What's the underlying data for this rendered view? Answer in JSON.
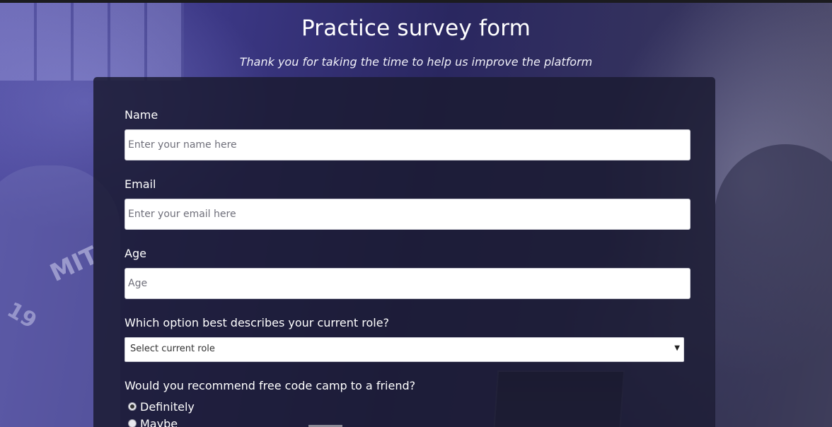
{
  "header": {
    "title": "Practice survey form",
    "description": "Thank you for taking the time to help us improve the platform"
  },
  "form": {
    "name": {
      "label": "Name",
      "placeholder": "Enter your name here"
    },
    "email": {
      "label": "Email",
      "placeholder": "Enter your email here"
    },
    "age": {
      "label": "Age",
      "placeholder": "Age"
    },
    "role": {
      "label": "Which option best describes your current role?",
      "selected": "Select current role",
      "arrow": "▼"
    },
    "recommend": {
      "label": "Would you recommend free code camp to a friend?",
      "options": [
        {
          "label": "Definitely",
          "checked": true
        },
        {
          "label": "Maybe",
          "checked": false
        }
      ]
    }
  },
  "background": {
    "shirt_text": "MIT",
    "shirt_number": "19"
  },
  "colors": {
    "card_bg": "#1b1b32",
    "text": "#ffffff",
    "page_bg": "#2e2a5c"
  }
}
